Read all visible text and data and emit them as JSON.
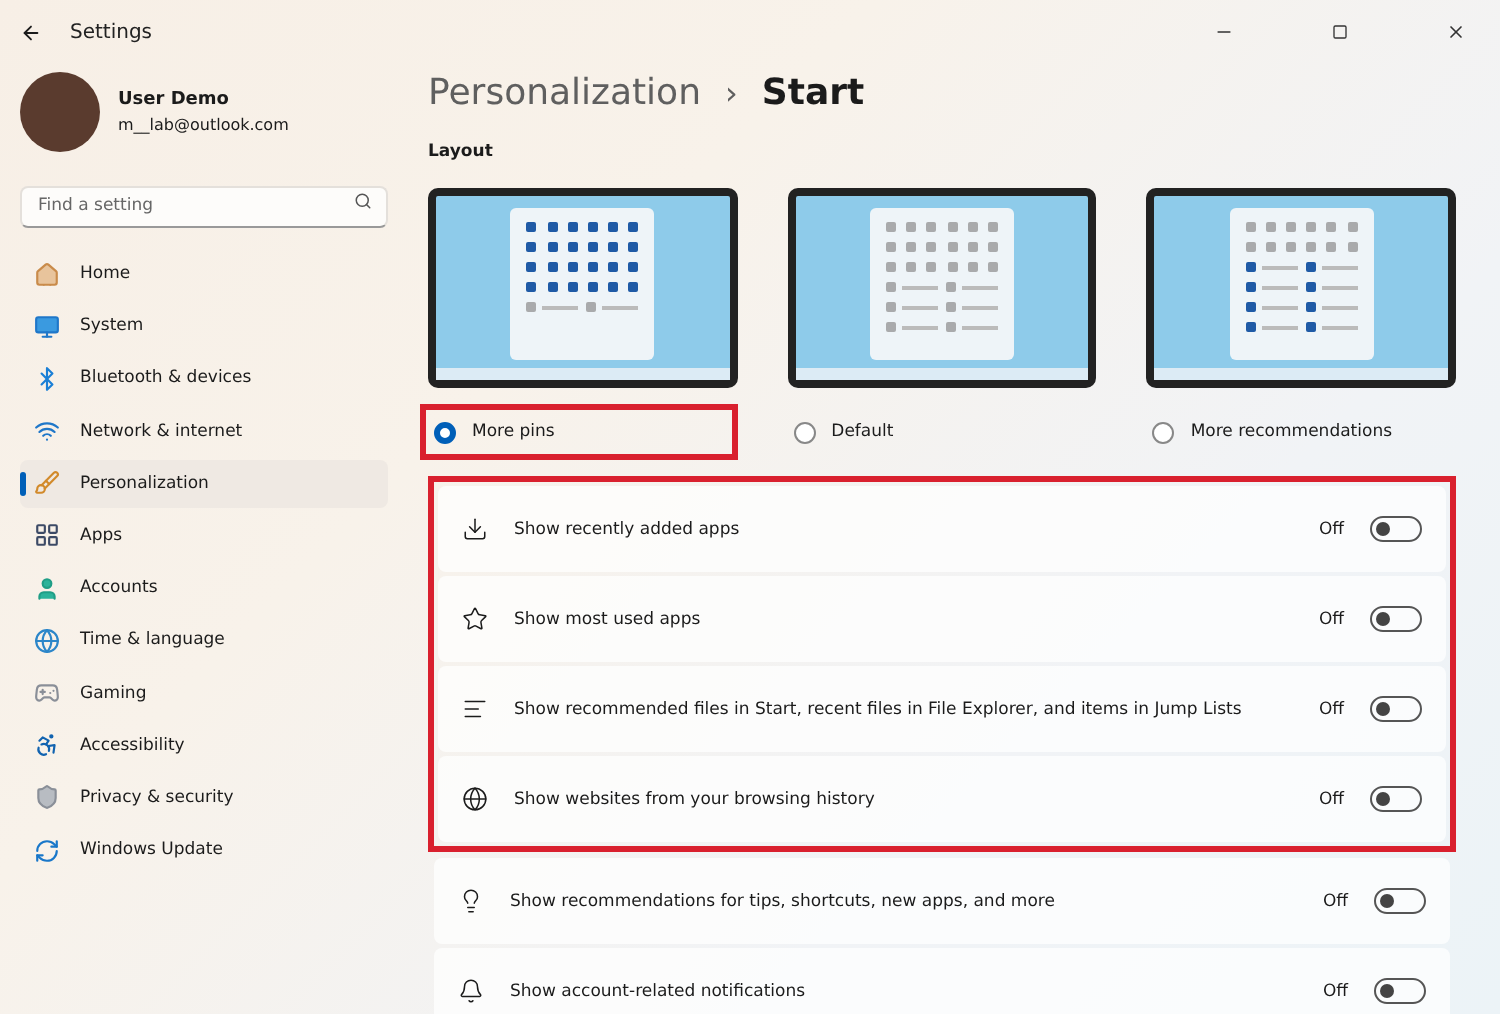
{
  "window": {
    "title": "Settings"
  },
  "user": {
    "name": "User Demo",
    "email": "m__lab@outlook.com"
  },
  "search": {
    "placeholder": "Find a setting"
  },
  "sidebar": {
    "items": [
      {
        "label": "Home",
        "selected": false
      },
      {
        "label": "System",
        "selected": false
      },
      {
        "label": "Bluetooth & devices",
        "selected": false
      },
      {
        "label": "Network & internet",
        "selected": false
      },
      {
        "label": "Personalization",
        "selected": true
      },
      {
        "label": "Apps",
        "selected": false
      },
      {
        "label": "Accounts",
        "selected": false
      },
      {
        "label": "Time & language",
        "selected": false
      },
      {
        "label": "Gaming",
        "selected": false
      },
      {
        "label": "Accessibility",
        "selected": false
      },
      {
        "label": "Privacy & security",
        "selected": false
      },
      {
        "label": "Windows Update",
        "selected": false
      }
    ]
  },
  "breadcrumb": {
    "parent": "Personalization",
    "separator": "›",
    "current": "Start"
  },
  "layout": {
    "heading": "Layout",
    "options": [
      {
        "label": "More pins",
        "selected": true,
        "highlighted": true
      },
      {
        "label": "Default",
        "selected": false,
        "highlighted": false
      },
      {
        "label": "More recommendations",
        "selected": false,
        "highlighted": false
      }
    ]
  },
  "settings": [
    {
      "label": "Show recently added apps",
      "state": "Off",
      "on": false,
      "highlighted": true
    },
    {
      "label": "Show most used apps",
      "state": "Off",
      "on": false,
      "highlighted": true
    },
    {
      "label": "Show recommended files in Start, recent files in File Explorer, and items in Jump Lists",
      "state": "Off",
      "on": false,
      "highlighted": true
    },
    {
      "label": "Show websites from your browsing history",
      "state": "Off",
      "on": false,
      "highlighted": true
    },
    {
      "label": "Show recommendations for tips, shortcuts, new apps, and more",
      "state": "Off",
      "on": false,
      "highlighted": false
    },
    {
      "label": "Show account-related notifications",
      "state": "Off",
      "on": false,
      "highlighted": false
    }
  ]
}
